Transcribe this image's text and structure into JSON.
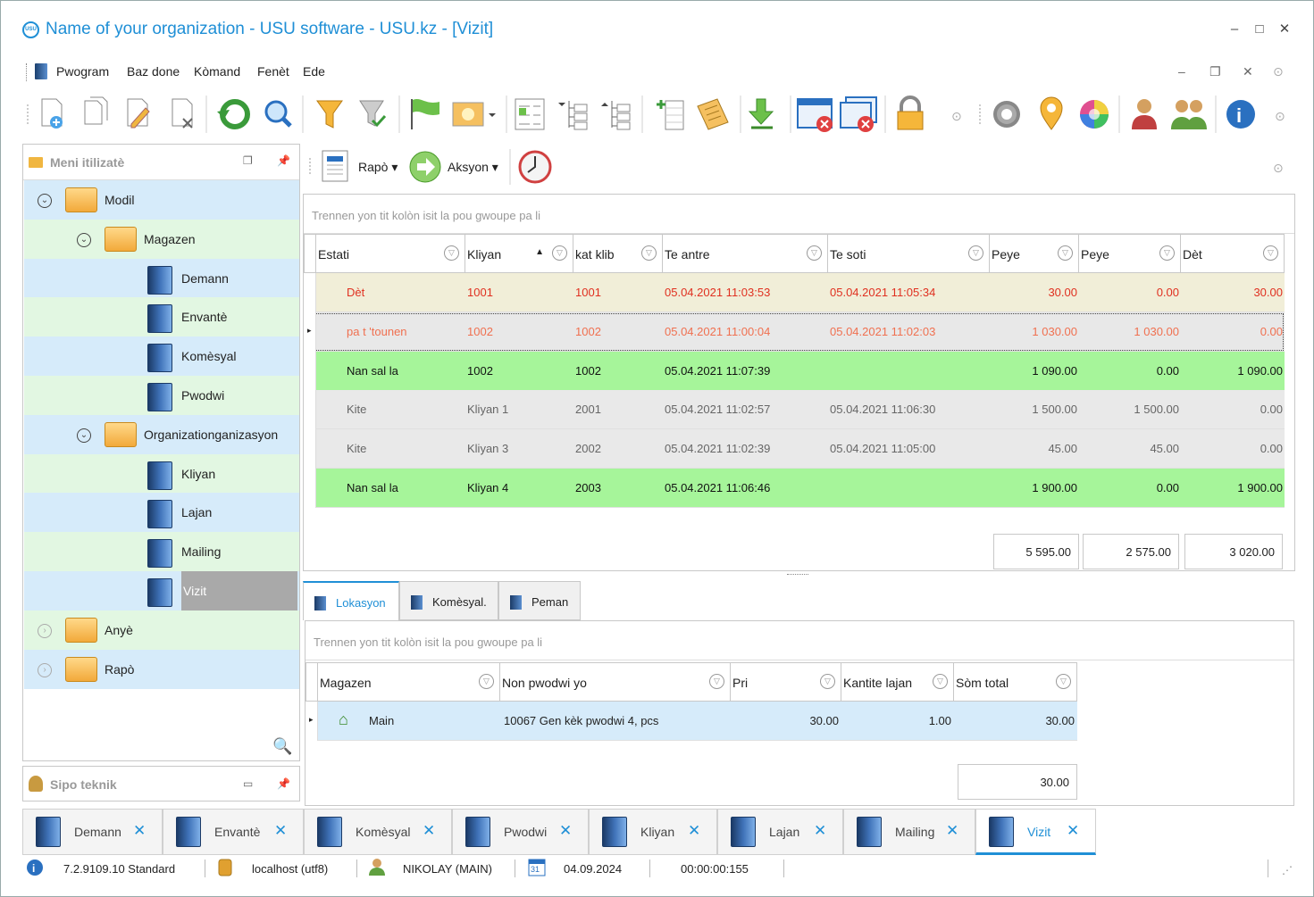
{
  "window": {
    "title": "Name of your organization - USU software - USU.kz - [Vizit]",
    "logo_text": "USU",
    "minimize": "–",
    "maximize": "□",
    "close": "✕"
  },
  "menu": [
    "Pwogram",
    "Baz done",
    "Kòmand",
    "Fenèt",
    "Ede"
  ],
  "toolbar_icons": [
    "add-record-icon",
    "copy-icon",
    "edit-icon",
    "delete-icon",
    "refresh-icon",
    "search-icon",
    "filter-icon",
    "filter-check-icon",
    "flag-icon",
    "picture-icon",
    "expand-columns-icon",
    "tree-expand-icon",
    "tree-collapse-icon",
    "add-column-icon",
    "notes-icon",
    "download-icon",
    "close-window-icon",
    "close-all-windows-icon",
    "lock-icon",
    "settings-icon",
    "map-pin-icon",
    "color-wheel-icon",
    "user-edit-icon",
    "users-icon",
    "info-icon"
  ],
  "left_panel": {
    "title": "Meni itilizatè",
    "tree": [
      {
        "label": "Modil",
        "level": 0,
        "type": "folder",
        "expanded": true
      },
      {
        "label": "Magazen",
        "level": 1,
        "type": "folder",
        "expanded": true
      },
      {
        "label": "Demann",
        "level": 2,
        "type": "book"
      },
      {
        "label": "Envantè",
        "level": 2,
        "type": "book"
      },
      {
        "label": "Komèsyal",
        "level": 2,
        "type": "book"
      },
      {
        "label": "Pwodwi",
        "level": 2,
        "type": "book"
      },
      {
        "label": "Organizationganizasyon",
        "level": 1,
        "type": "folder",
        "expanded": true
      },
      {
        "label": "Kliyan",
        "level": 2,
        "type": "book"
      },
      {
        "label": "Lajan",
        "level": 2,
        "type": "book"
      },
      {
        "label": "Mailing",
        "level": 2,
        "type": "book"
      },
      {
        "label": "Vizit",
        "level": 2,
        "type": "book",
        "selected": true
      },
      {
        "label": "Anyè",
        "level": 0,
        "type": "folder",
        "expanded": false
      },
      {
        "label": "Rapò",
        "level": 0,
        "type": "folder",
        "expanded": false
      }
    ]
  },
  "sipo": {
    "title": "Sipo teknik"
  },
  "actions": {
    "report": "Rapò",
    "action": "Aksyon"
  },
  "grid1": {
    "group_hint": "Trennen yon tit kolòn isit la pou gwoupe pa li",
    "columns": [
      "Estati",
      "Kliyan",
      "kat klib",
      "Te antre",
      "Te soti",
      "Peye",
      "Peye",
      "Dèt"
    ],
    "rows": [
      {
        "c": [
          "Dèt",
          "1001",
          "1001",
          "05.04.2021 11:03:53",
          "05.04.2021 11:05:34",
          "30.00",
          "0.00",
          "30.00"
        ],
        "style": "debt"
      },
      {
        "c": [
          "pa t 'tounen",
          "1002",
          "1002",
          "05.04.2021 11:00:04",
          "05.04.2021 11:02:03",
          "1 030.00",
          "1 030.00",
          "0.00"
        ],
        "style": "notreturned"
      },
      {
        "c": [
          "Nan sal la",
          "1002",
          "1002",
          "05.04.2021 11:07:39",
          "",
          "1 090.00",
          "0.00",
          "1 090.00"
        ],
        "style": "inroom"
      },
      {
        "c": [
          "Kite",
          "Kliyan 1",
          "2001",
          "05.04.2021 11:02:57",
          "05.04.2021 11:06:30",
          "1 500.00",
          "1 500.00",
          "0.00"
        ],
        "style": "left"
      },
      {
        "c": [
          "Kite",
          "Kliyan 3",
          "2002",
          "05.04.2021 11:02:39",
          "05.04.2021 11:05:00",
          "45.00",
          "45.00",
          "0.00"
        ],
        "style": "left"
      },
      {
        "c": [
          "Nan sal la",
          "Kliyan 4",
          "2003",
          "05.04.2021 11:06:46",
          "",
          "1 900.00",
          "0.00",
          "1 900.00"
        ],
        "style": "inroom"
      }
    ],
    "totals": [
      "5 595.00",
      "2 575.00",
      "3 020.00"
    ]
  },
  "tabs": [
    "Lokasyon",
    "Komèsyal.",
    "Peman"
  ],
  "grid2": {
    "group_hint": "Trennen yon tit kolòn isit la pou gwoupe pa li",
    "columns": [
      "Magazen",
      "Non pwodwi yo",
      "Pri",
      "Kantite lajan",
      "Sòm total"
    ],
    "rows": [
      {
        "c": [
          "Main",
          "10067 Gen kèk pwodwi 4, pcs",
          "30.00",
          "1.00",
          "30.00"
        ]
      }
    ],
    "total": "30.00"
  },
  "bottom_tabs": [
    "Demann",
    "Envantè",
    "Komèsyal",
    "Pwodwi",
    "Kliyan",
    "Lajan",
    "Mailing",
    "Vizit"
  ],
  "status": {
    "version": "7.2.9109.10 Standard",
    "db": "localhost (utf8)",
    "user": "NIKOLAY (MAIN)",
    "cal": "31",
    "date": "04.09.2024",
    "timer": "00:00:00:155"
  }
}
